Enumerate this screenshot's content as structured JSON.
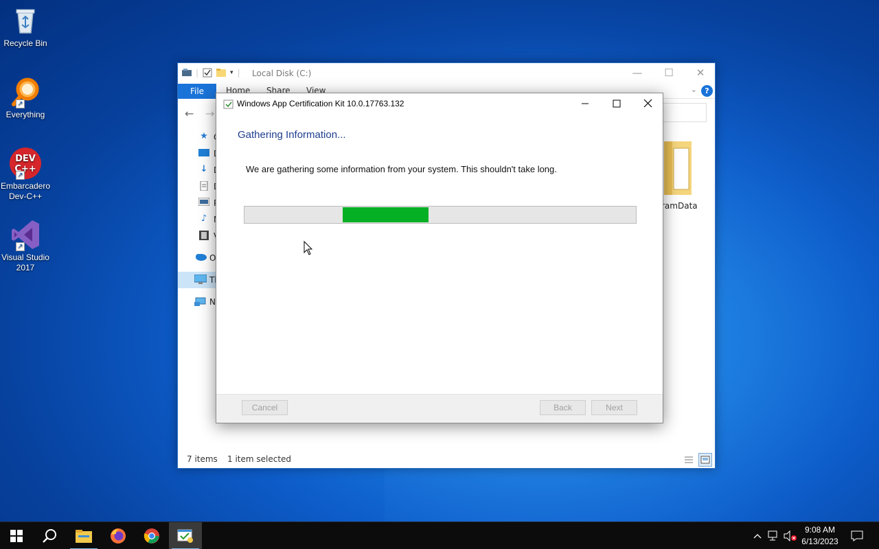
{
  "desktop": {
    "icons": [
      {
        "label": "Recycle Bin",
        "icon": "recycle-bin-icon"
      },
      {
        "label": "Everything",
        "icon": "everything-search-icon"
      },
      {
        "label": "Embarcadero Dev-C++",
        "icon": "devcpp-icon",
        "badge": "DEV C++"
      },
      {
        "label": "Visual Studio 2017",
        "icon": "visual-studio-icon"
      }
    ]
  },
  "explorer": {
    "title": "Local Disk (C:)",
    "ribbon_tabs": [
      "File",
      "Home",
      "Share",
      "View"
    ],
    "sidebar": [
      {
        "label": "Qu",
        "icon": "quick-access-star-icon"
      },
      {
        "label": "D",
        "icon": "desktop-folder-icon"
      },
      {
        "label": "D",
        "icon": "downloads-folder-icon"
      },
      {
        "label": "D",
        "icon": "documents-folder-icon"
      },
      {
        "label": "P",
        "icon": "pictures-folder-icon"
      },
      {
        "label": "M",
        "icon": "music-folder-icon"
      },
      {
        "label": "V",
        "icon": "videos-folder-icon"
      },
      {
        "label": "Or",
        "icon": "onedrive-cloud-icon"
      },
      {
        "label": "Th",
        "icon": "this-pc-icon"
      },
      {
        "label": "Ne",
        "icon": "network-icon"
      }
    ],
    "visible_item": "ramData",
    "status": {
      "items": "7 items",
      "selected": "1 item selected"
    }
  },
  "dialog": {
    "title": "Windows App Certification Kit 10.0.17763.132",
    "heading": "Gathering Information...",
    "message": "We are gathering some information from your system. This shouldn't take long.",
    "progress": {
      "segment_start": 0.25,
      "segment_end": 0.47,
      "color": "#06b025"
    },
    "buttons": {
      "cancel": "Cancel",
      "back": "Back",
      "next": "Next"
    }
  },
  "taskbar": {
    "apps": [
      "start-icon",
      "search-icon",
      "file-explorer-icon",
      "firefox-icon",
      "chrome-icon",
      "app-cert-kit-icon"
    ],
    "clock": {
      "time": "9:08 AM",
      "date": "6/13/2023"
    }
  }
}
